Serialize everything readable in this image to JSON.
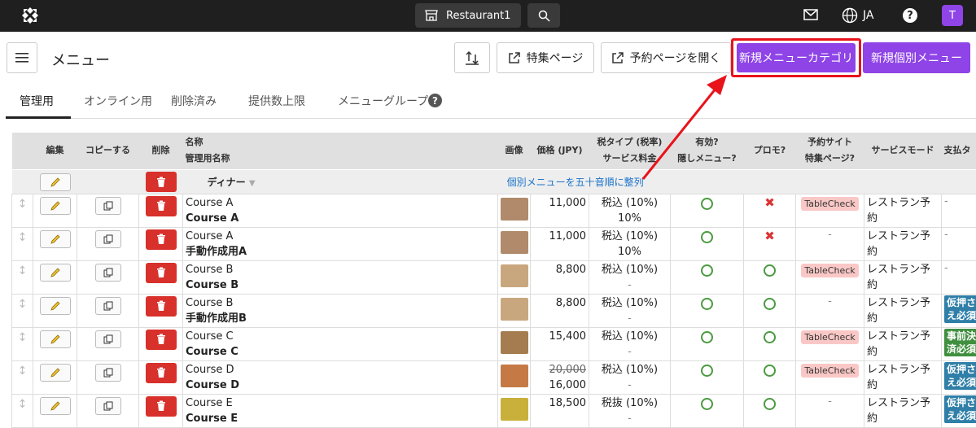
{
  "topbar": {
    "restaurant": "Restaurant1",
    "lang": "JA",
    "avatar": "T",
    "help": "?"
  },
  "header": {
    "title": "メニュー",
    "feature_page": "特集ページ",
    "open_reservation": "予約ページを開く",
    "new_category": "新規メニューカテゴリ",
    "new_item": "新規個別メニュー"
  },
  "tabs": [
    "管理用",
    "オンライン用",
    "削除済み",
    "提供数上限",
    "メニューグループ"
  ],
  "tab_help": "?",
  "columns": {
    "edit": "編集",
    "copy": "コピーする",
    "delete": "削除",
    "name": "名称",
    "name_admin": "管理用名称",
    "image": "画像",
    "price": "価格 (JPY)",
    "tax": "税タイプ (税率)",
    "service": "サービス料金",
    "active": "有効?",
    "hidden": "隠しメニュー?",
    "promo": "プロモ?",
    "site": "予約サイト",
    "site_feature": "特集ページ?",
    "mode": "サービスモード",
    "pay": "支払タ"
  },
  "group": {
    "name": "ディナー",
    "sort_link": "個別メニューを五十音順に整列"
  },
  "rows": [
    {
      "name": "Course A",
      "admin": "Course A",
      "price": "11,000",
      "old_price": "",
      "tax": "税込 (10%)",
      "service": "10%",
      "active": "ok",
      "promo": "x",
      "site": "TableCheck",
      "mode": "レストラン予約",
      "pay": "-",
      "pay_color": "",
      "img": "#b08a6a"
    },
    {
      "name": "Course A",
      "admin": "手動作成用A",
      "price": "11,000",
      "old_price": "",
      "tax": "税込 (10%)",
      "service": "10%",
      "active": "ok",
      "promo": "x",
      "site": "-",
      "mode": "レストラン予約",
      "pay": "-",
      "pay_color": "",
      "img": "#b08a6a"
    },
    {
      "name": "Course B",
      "admin": "Course B",
      "price": "8,800",
      "old_price": "",
      "tax": "税込 (10%)",
      "service": "-",
      "active": "ok",
      "promo": "ok",
      "site": "TableCheck",
      "mode": "レストラン予約",
      "pay": "-",
      "pay_color": "",
      "img": "#c9a77e"
    },
    {
      "name": "Course B",
      "admin": "手動作成用B",
      "price": "8,800",
      "old_price": "",
      "tax": "税込 (10%)",
      "service": "-",
      "active": "ok",
      "promo": "ok",
      "site": "-",
      "mode": "レストラン予約",
      "pay": "仮押さえ必須",
      "pay_color": "#2f7fa8",
      "img": "#c9a77e"
    },
    {
      "name": "Course C",
      "admin": "Course C",
      "price": "15,400",
      "old_price": "",
      "tax": "税込 (10%)",
      "service": "-",
      "active": "ok",
      "promo": "ok",
      "site": "TableCheck",
      "mode": "レストラン予約",
      "pay": "事前決済必須",
      "pay_color": "#3f8f3f",
      "img": "#a57c4f"
    },
    {
      "name": "Course D",
      "admin": "Course D",
      "price": "16,000",
      "old_price": "20,000",
      "tax": "税込 (10%)",
      "service": "-",
      "active": "ok",
      "promo": "ok",
      "site": "TableCheck",
      "mode": "レストラン予約",
      "pay": "仮押さえ必須",
      "pay_color": "#2f7fa8",
      "img": "#c57a45"
    },
    {
      "name": "Course E",
      "admin": "Course E",
      "price": "18,500",
      "old_price": "",
      "tax": "税抜 (10%)",
      "service": "-",
      "active": "ok",
      "promo": "ok",
      "site": "-",
      "mode": "レストラン予約",
      "pay": "仮押さえ必須",
      "pay_color": "#2f7fa8",
      "img": "#c8b03a"
    }
  ]
}
